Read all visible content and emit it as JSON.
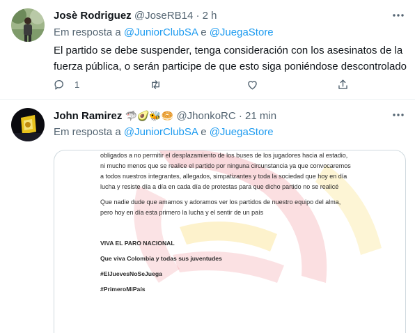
{
  "tweets": [
    {
      "name": "Josè Rodriguez",
      "handle": "@JoseRB14",
      "separator": "·",
      "time": "2 h",
      "reply_prefix": "Em resposta a",
      "mention1": "@JuniorClubSA",
      "conj": "e",
      "mention2": "@JuegaStore",
      "text": "El partido se debe suspender,  tenga consideración con los asesinatos de la fuerza pública, o serán participe de que esto siga poniéndose descontrolado",
      "reply_count": "1",
      "more_icon": "more-dots-icon"
    },
    {
      "name": "John Ramirez",
      "emojis": "🦈🥑🐝🥯",
      "handle": "@JhonkoRC",
      "separator": "·",
      "time": "21 min",
      "reply_prefix": "Em resposta a",
      "mention1": "@JuniorClubSA",
      "conj": "e",
      "mention2": "@JuegaStore",
      "more_icon": "more-dots-icon"
    }
  ],
  "attachment": {
    "lines": [
      "obligados a no permitir el desplazamiento de los buses de los jugadores hacia al estadio,",
      "ni mucho menos que se realice el partido por ninguna circunstancia ya que convocaremos",
      "a todos nuestros integrantes, allegados, simpatizantes y toda la sociedad que hoy en día",
      "lucha y resiste día a día en cada día de protestas para que dicho partido no se realicé",
      "Que nadie dude que amamos y adoramos ver los partidos de nuestro equipo del alma,",
      "pero hoy en día esta primero la lucha y el sentir de un país",
      "VIVA EL PARO NACIONAL",
      "Que viva Colombia y todas sus juventudes",
      "#ElJuevesNoSeJuega",
      "#PrimeroMiPaís"
    ]
  },
  "colors": {
    "link": "#1d9bf0",
    "muted": "#536471",
    "text": "#0f1419",
    "watermark_red": "#e63946",
    "watermark_yellow": "#f5c518"
  }
}
